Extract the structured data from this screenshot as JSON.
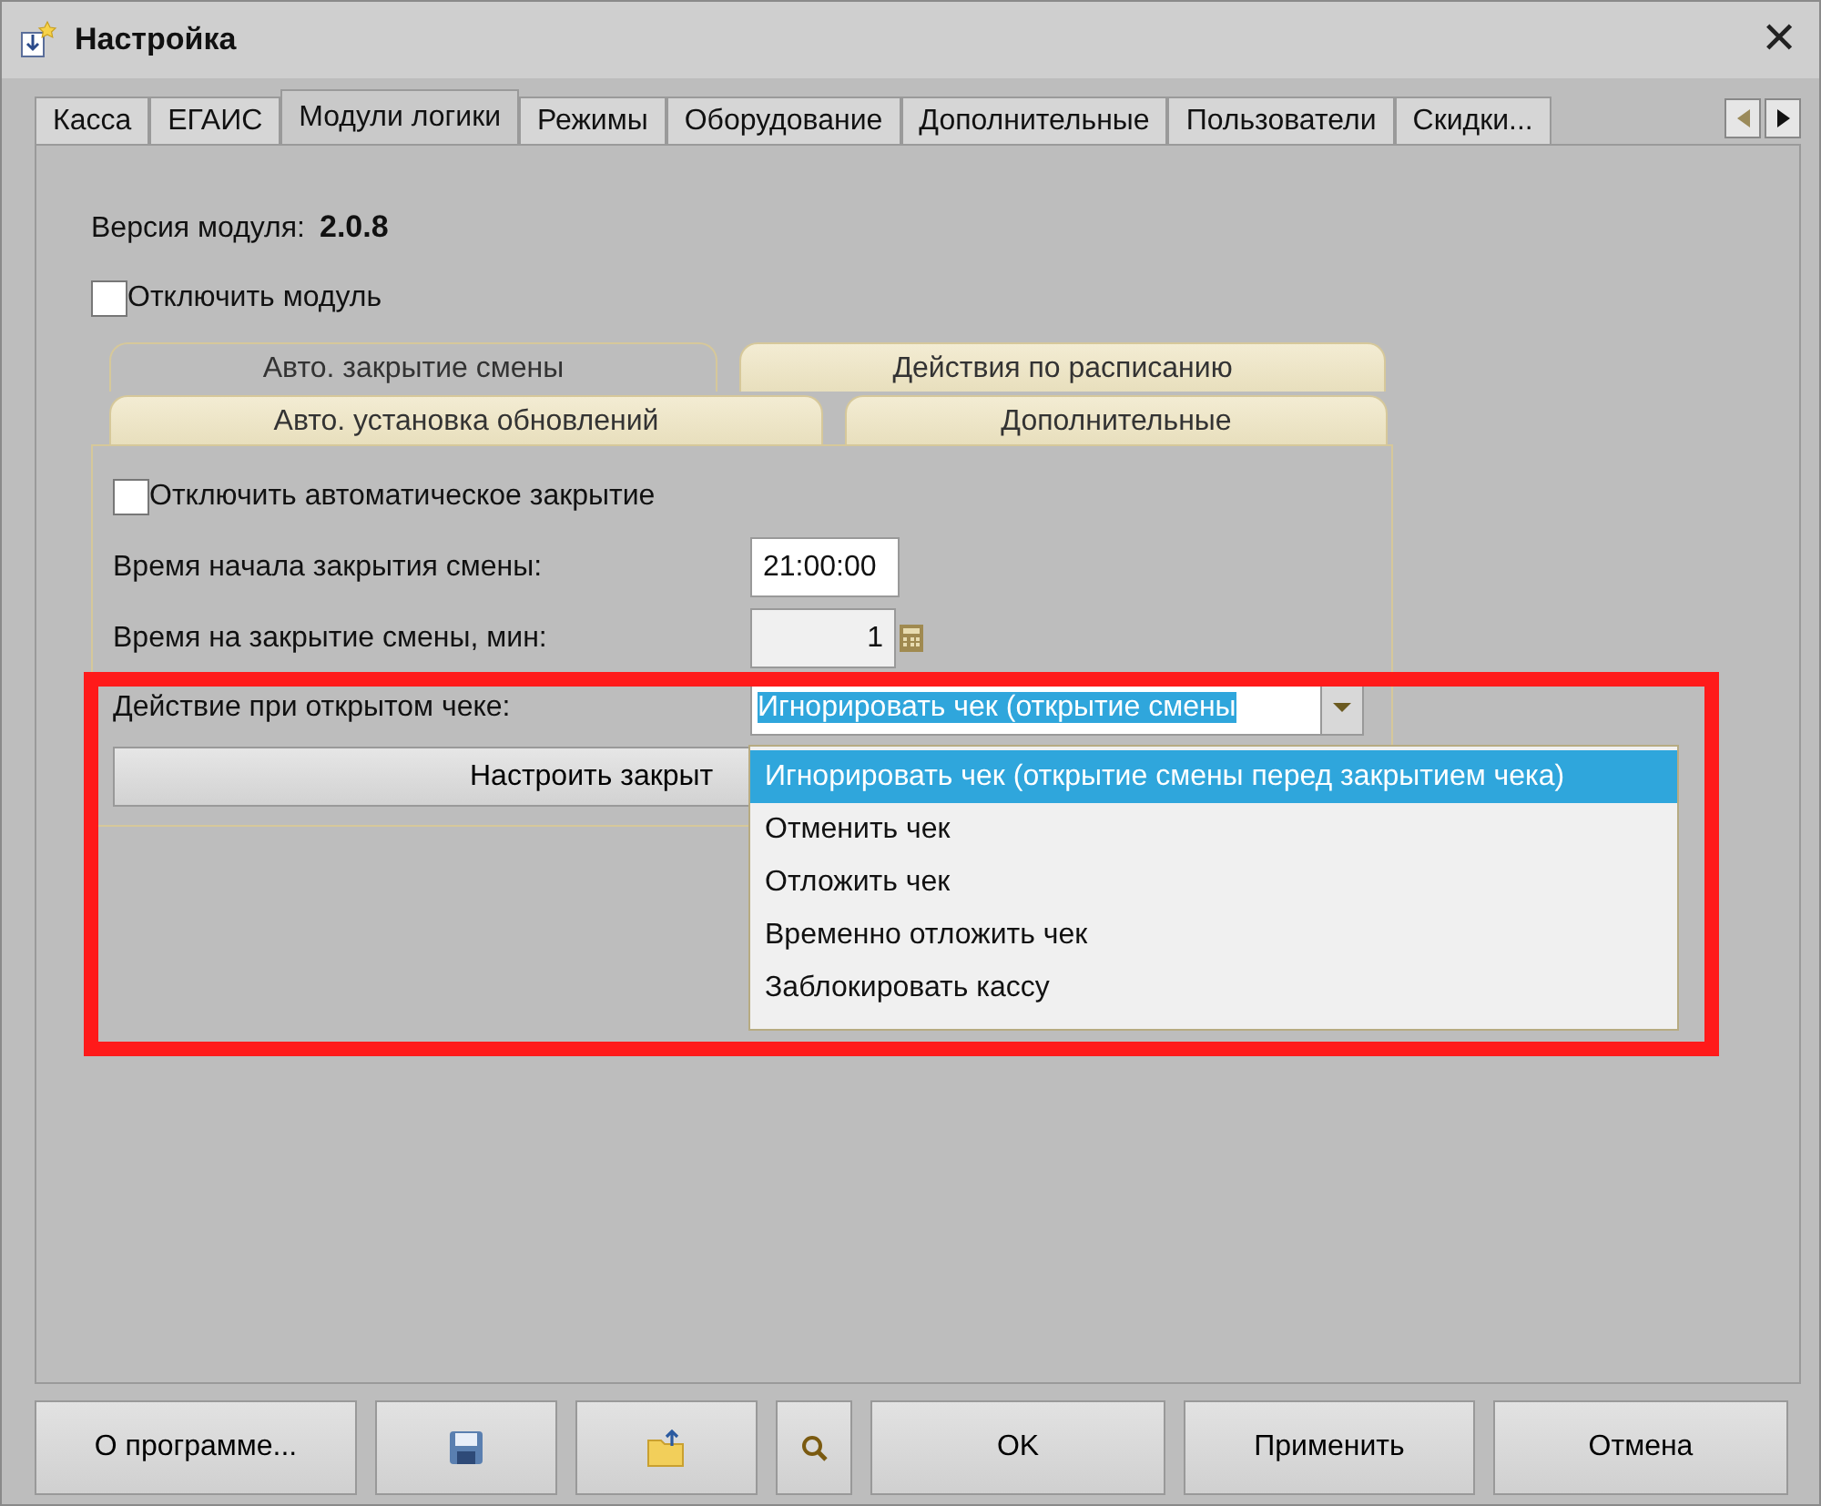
{
  "window": {
    "title": "Настройка",
    "close": "✕"
  },
  "tabs": [
    {
      "label": "Касса",
      "selected": false
    },
    {
      "label": "ЕГАИС",
      "selected": false
    },
    {
      "label": "Модули логики",
      "selected": true
    },
    {
      "label": "Режимы",
      "selected": false
    },
    {
      "label": "Оборудование",
      "selected": false
    },
    {
      "label": "Дополнительные",
      "selected": false
    },
    {
      "label": "Пользователи",
      "selected": false
    },
    {
      "label": "Скидки...",
      "selected": false
    }
  ],
  "module_version": {
    "label": "Версия модуля:",
    "value": "2.0.8"
  },
  "disable_module": {
    "label": "Отключить модуль",
    "checked": false
  },
  "inner_tab_rows": [
    {
      "tabs": [
        {
          "label": "Авто. закрытие смены",
          "selected": true
        },
        {
          "label": "Действия по расписанию",
          "selected": false
        }
      ]
    },
    {
      "tabs": [
        {
          "label": "Авто. установка обновлений",
          "selected": false
        },
        {
          "label": "Дополнительные",
          "selected": false
        }
      ]
    }
  ],
  "disable_auto_close": {
    "label": "Отключить автоматическое закрытие",
    "checked": false
  },
  "fields": [
    {
      "kind": "time",
      "label": "Время начала закрытия смены:",
      "value": "21:00:00"
    },
    {
      "kind": "number",
      "label": "Время на закрытие смены, мин:",
      "value": "1"
    },
    {
      "kind": "combo",
      "label": "Действие при открытом чеке:",
      "value": "Игнорировать чек (открытие смены"
    }
  ],
  "setup_button": {
    "label": "Настроить закрыт"
  },
  "dropdown": [
    {
      "label": "Игнорировать чек (открытие смены перед закрытием чека)",
      "selected": true
    },
    {
      "label": "Отменить чек",
      "selected": false
    },
    {
      "label": "Отложить чек",
      "selected": false
    },
    {
      "label": "Временно отложить чек",
      "selected": false
    },
    {
      "label": "Заблокировать кассу",
      "selected": false
    }
  ],
  "buttons": [
    {
      "kind": "text",
      "label": "О программе..."
    },
    {
      "kind": "save"
    },
    {
      "kind": "open"
    },
    {
      "kind": "search"
    },
    {
      "kind": "text",
      "label": "OK"
    },
    {
      "kind": "text",
      "label": "Применить"
    },
    {
      "kind": "text",
      "label": "Отмена"
    }
  ]
}
